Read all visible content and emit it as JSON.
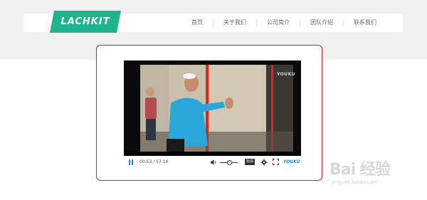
{
  "brand": {
    "logo_text": "LACHKIT",
    "logo_color": "#20b48e"
  },
  "nav": {
    "items": [
      {
        "label": "首页"
      },
      {
        "label": "关于我们"
      },
      {
        "label": "公司简介"
      },
      {
        "label": "团队介绍"
      },
      {
        "label": "联系我们"
      }
    ]
  },
  "player": {
    "watermark": "YOUKU",
    "current_time": "00:53",
    "separator": " / ",
    "duration": "57:10",
    "quality_label": "标清",
    "provider_logo": "YOUKU",
    "progress_fraction": 0.015,
    "frame_border_color": "#d3202e",
    "accent_color": "#1c8cd8"
  },
  "watermark": {
    "main_text": "Bai 经验",
    "url_text": "jingyan.baidu.com"
  }
}
